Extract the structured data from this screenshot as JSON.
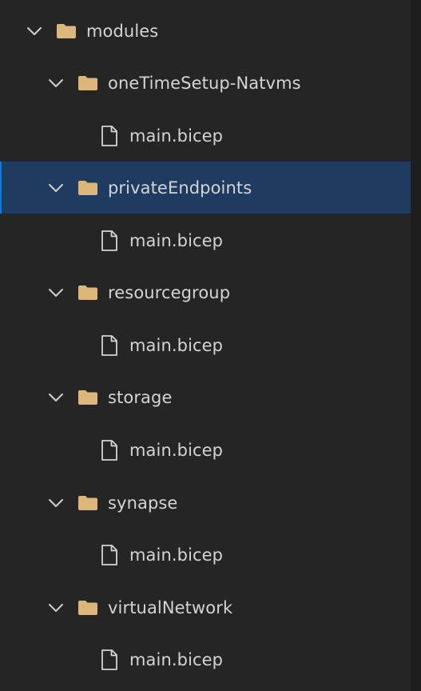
{
  "explorer": {
    "root": {
      "name": "modules",
      "expanded": true,
      "icons": {
        "chevron": "chevron-down-icon",
        "folder": "folder-icon"
      }
    },
    "folders": [
      {
        "name": "oneTimeSetup-Natvms",
        "expanded": true,
        "selected": false,
        "file": "main.bicep"
      },
      {
        "name": "privateEndpoints",
        "expanded": true,
        "selected": true,
        "file": "main.bicep"
      },
      {
        "name": "resourcegroup",
        "expanded": true,
        "selected": false,
        "file": "main.bicep"
      },
      {
        "name": "storage",
        "expanded": true,
        "selected": false,
        "file": "main.bicep"
      },
      {
        "name": "synapse",
        "expanded": true,
        "selected": false,
        "file": "main.bicep"
      },
      {
        "name": "virtualNetwork",
        "expanded": true,
        "selected": false,
        "file": "main.bicep"
      }
    ],
    "file_icon": "file-icon",
    "colors": {
      "background": "#252526",
      "selection": "#1f3b5f",
      "selection_border": "#1177d9",
      "folder": "#dcb67a",
      "text": "#d4d4d4",
      "icon": "#d4d4d4"
    }
  }
}
